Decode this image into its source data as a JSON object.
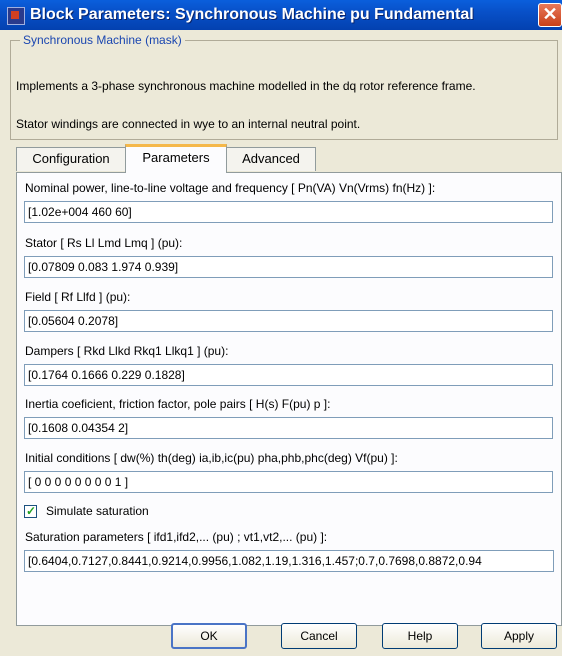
{
  "window": {
    "title": "Block Parameters: Synchronous Machine pu Fundamental"
  },
  "mask": {
    "legend": "Synchronous Machine (mask)",
    "description_1": "Implements a 3-phase synchronous machine modelled in the dq rotor reference frame.",
    "description_2": "Stator windings are connected in wye to an internal neutral point."
  },
  "tabs": [
    "Configuration",
    "Parameters",
    "Advanced"
  ],
  "active_tab": "Parameters",
  "parameters": [
    {
      "label": "Nominal power, line-to-line voltage and frequency [ Pn(VA)  Vn(Vrms)  fn(Hz) ]:",
      "value": "[1.02e+004 460 60]"
    },
    {
      "label": "Stator  [ Rs  Ll  Lmd  Lmq ] (pu):",
      "value": "[0.07809 0.083 1.974 0.939]"
    },
    {
      "label": "Field  [ Rf  Llfd ] (pu):",
      "value": "[0.05604 0.2078]"
    },
    {
      "label": "Dampers  [ Rkd  Llkd  Rkq1  Llkq1 ] (pu):",
      "value": "[0.1764 0.1666 0.229 0.1828]"
    },
    {
      "label": "Inertia coeficient, friction factor, pole pairs [ H(s)  F(pu)  p ]:",
      "value": "[0.1608 0.04354 2]"
    },
    {
      "label": "Initial conditions [ dw(%)  th(deg)  ia,ib,ic(pu)  pha,phb,phc(deg)  Vf(pu) ]:",
      "value": "[ 0  0  0  0  0  0  0  0  1 ]"
    }
  ],
  "simulate_saturation": {
    "label": "Simulate saturation",
    "checked": true
  },
  "saturation": {
    "label": "Saturation parameters [ ifd1,ifd2,... (pu) ; vt1,vt2,... (pu) ]:",
    "value": "[0.6404,0.7127,0.8441,0.9214,0.9956,1.082,1.19,1.316,1.457;0.7,0.7698,0.8872,0.94"
  },
  "buttons": {
    "ok": "OK",
    "cancel": "Cancel",
    "help": "Help",
    "apply": "Apply"
  },
  "colors": {
    "title_bar": "#0850c8",
    "dialog_bg": "#ece9d8",
    "active_tab_highlight": "#f5b84a"
  }
}
